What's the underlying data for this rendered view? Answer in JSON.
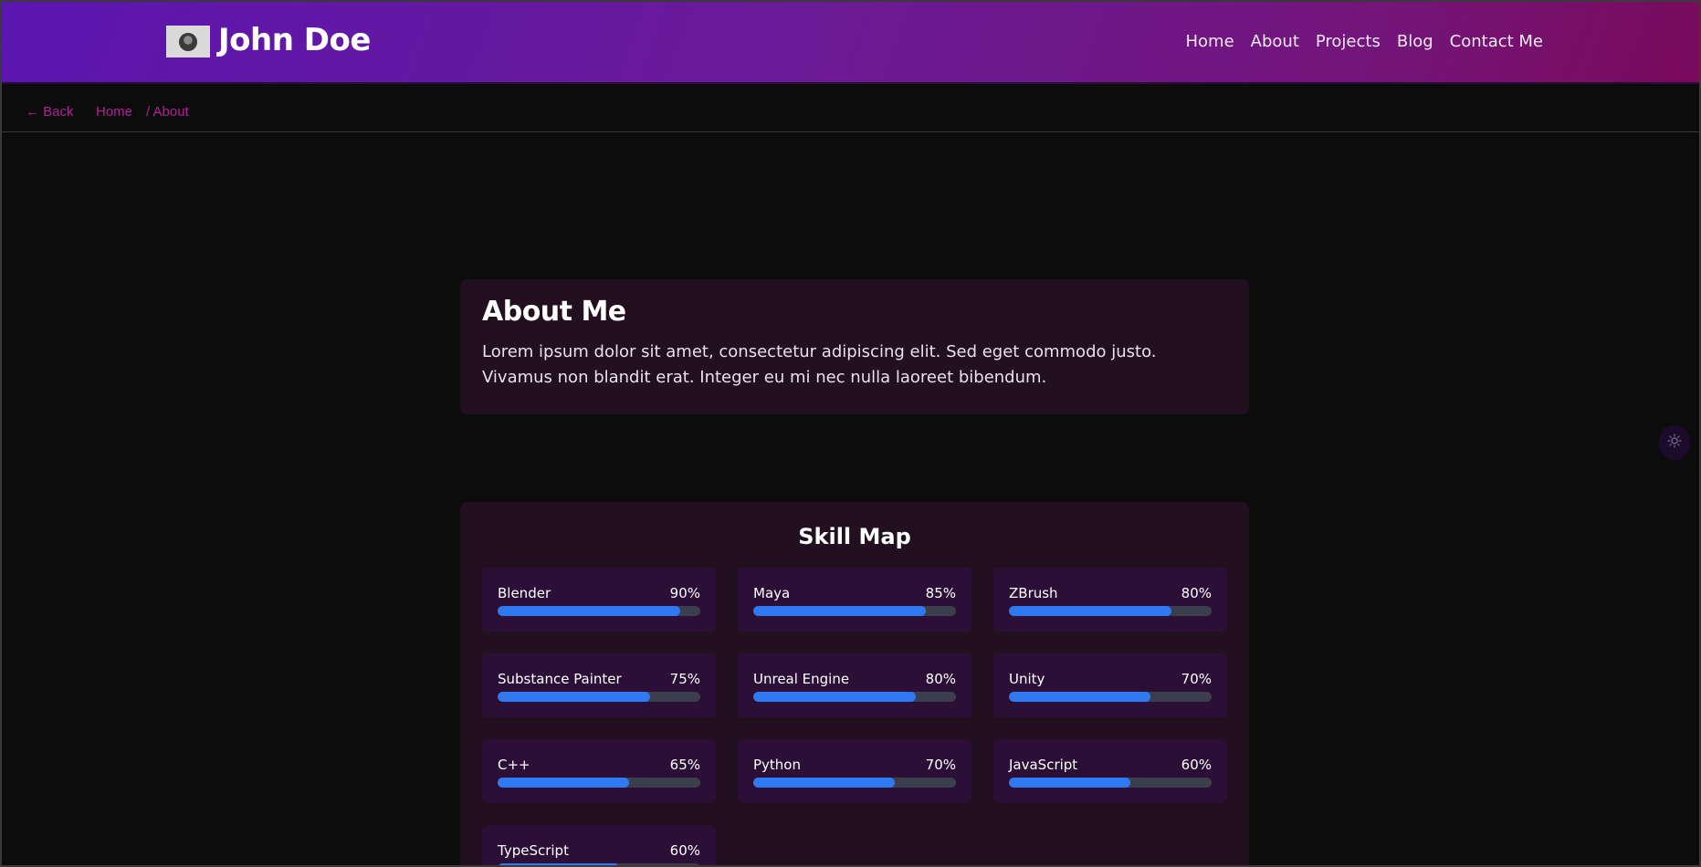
{
  "header": {
    "brand": "John Doe",
    "nav": [
      "Home",
      "About",
      "Projects",
      "Blog",
      "Contact Me"
    ]
  },
  "subbar": {
    "back_label": "← Back",
    "breadcrumb_home": "Home",
    "breadcrumb_current": "/ About"
  },
  "about": {
    "title": "About Me",
    "body": "Lorem ipsum dolor sit amet, consectetur adipiscing elit. Sed eget commodo justo. Vivamus non blandit erat. Integer eu mi nec nulla laoreet bibendum."
  },
  "skills": {
    "title": "Skill Map",
    "items": [
      {
        "name": "Blender",
        "percent_label": "90%",
        "level": 90
      },
      {
        "name": "Maya",
        "percent_label": "85%",
        "level": 85
      },
      {
        "name": "ZBrush",
        "percent_label": "80%",
        "level": 80
      },
      {
        "name": "Substance Painter",
        "percent_label": "75%",
        "level": 75
      },
      {
        "name": "Unreal Engine",
        "percent_label": "80%",
        "level": 80
      },
      {
        "name": "Unity",
        "percent_label": "70%",
        "level": 70
      },
      {
        "name": "C++",
        "percent_label": "65%",
        "level": 65
      },
      {
        "name": "Python",
        "percent_label": "70%",
        "level": 70
      },
      {
        "name": "JavaScript",
        "percent_label": "60%",
        "level": 60
      },
      {
        "name": "TypeScript",
        "percent_label": "60%",
        "level": 60
      }
    ]
  },
  "theme_toggle": {
    "icon": "sun-icon"
  },
  "colors": {
    "accent_link": "#b0229a",
    "bar_fill": "#2f7af2",
    "bar_track": "#3b3f4d",
    "card_bg": "#221020",
    "skill_bg": "#2b0f36"
  }
}
